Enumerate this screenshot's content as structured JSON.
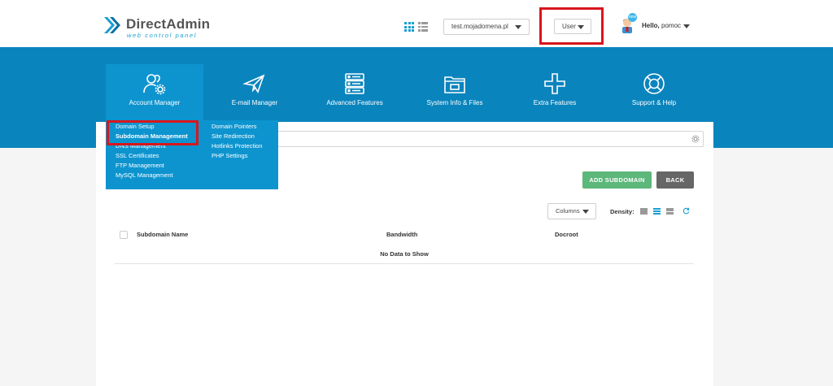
{
  "brand": {
    "title": "DirectAdmin",
    "subtitle": "web control panel"
  },
  "header": {
    "domain_select": "test.mojadomena.pl",
    "user_select": "User",
    "greeting": "Hello,",
    "username": "pomoc",
    "avatar_badge": "new"
  },
  "nav": {
    "items": [
      {
        "label": "Account Manager",
        "icon": "users-gear-icon"
      },
      {
        "label": "E-mail Manager",
        "icon": "paper-plane-icon"
      },
      {
        "label": "Advanced Features",
        "icon": "server-stack-icon"
      },
      {
        "label": "System Info & Files",
        "icon": "folder-icon"
      },
      {
        "label": "Extra Features",
        "icon": "plus-icon"
      },
      {
        "label": "Support & Help",
        "icon": "lifebuoy-icon"
      }
    ]
  },
  "dropdown": {
    "col1": [
      "Domain Setup",
      "Subdomain Management",
      "DNS Management",
      "SSL Certificates",
      "FTP Management",
      "MySQL Management"
    ],
    "col2": [
      "Domain Pointers",
      "Site Redirection",
      "Hotlinks Protection",
      "PHP Settings"
    ]
  },
  "toolbar": {
    "add_label": "ADD SUBDOMAIN",
    "back_label": "BACK",
    "columns_label": "Columns",
    "density_label": "Density:"
  },
  "table": {
    "headers": [
      "Subdomain Name",
      "Bandwidth",
      "Docroot"
    ],
    "empty_text": "No Data to Show"
  },
  "colors": {
    "brand_blue": "#0a84bd",
    "active_blue": "#0d94cf",
    "highlight_red": "#d9161c",
    "add_green": "#5cb77a"
  }
}
